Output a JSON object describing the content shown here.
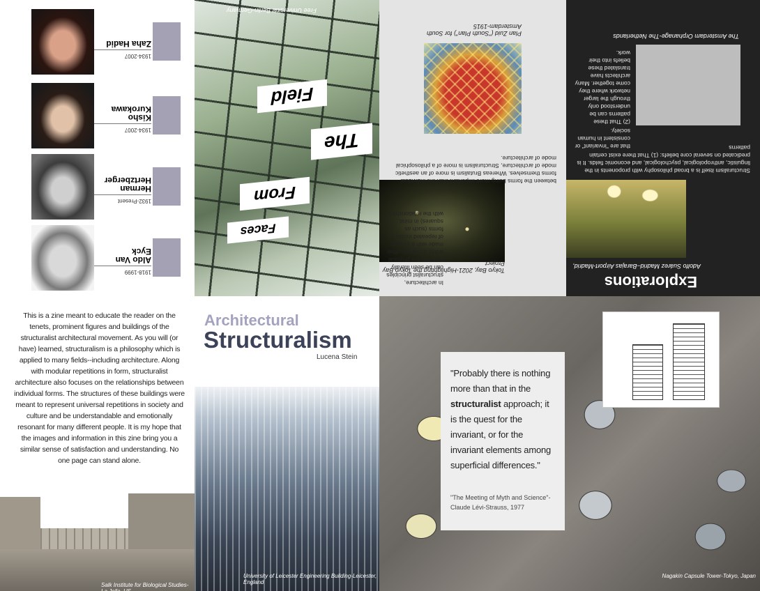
{
  "architects": [
    {
      "name": "Zaha Hadid",
      "years": "1934-2007"
    },
    {
      "name": "Kisho Kurokawa",
      "years": "1934-2007"
    },
    {
      "name": "Herman Hertzberger",
      "years": "1932-Present"
    },
    {
      "name": "Aldo Van Eyck",
      "years": "1918-1999"
    }
  ],
  "faces_panel": {
    "caption": "Free Universität Berlin-Germany",
    "words": [
      "Field",
      "The",
      "From",
      "Faces"
    ]
  },
  "tokyo_panel": {
    "plan_caption": "Plan Zuid (\"South Plan\") for South Amsterdam-1915",
    "tokyo_caption": "Tokyo Bay, 2021-Highlighting the Tokyo Bay Project",
    "text_left": "In architecture, structuralist principles can be seen literally built into the physical world. Buildings often made with a system of repeated motifs or forms (such as squares) in mind, with the relationships",
    "text_wide": "between the forms being more important than the individual forms themselves. Whereas Brutalism is more of an aesthetic mode of architecture, Structuralism is more of a philosophical mode of architecture."
  },
  "explorations_panel": {
    "title": "Explorations",
    "orphanage_caption": "The Amsterdam Orphanage-The Netherlands",
    "airport_caption": "Adolfo Suárez Madrid–Barajas Airport-Madrid,",
    "text_narrow": "(2) That these patterns can be understood only through the larger network where they come together. Many architects have translated these beliefs into their work.",
    "text_right": "that are \"invariant\" or consistent in human society.",
    "text_wide": "Structuralism itself is a broad philosophy with proponents in the linguistic, anthropological, psychological, and economic fields. It is predicated on several core beliefs: (1) That there exist certain patterns"
  },
  "intro": {
    "text": "This is a zine meant to educate the reader on the tenets, prominent figures and buildings of the structuralist architectural movement. As you will (or have) learned, structuralism is a philosophy which is applied to many fields--including architecture. Along with modular repetitions in form, structuralist architecture also focuses on the relationships between individual forms. The structures of these buildings were meant to represent universal repetitions in society and culture and be understandable and emotionally resonant for many different people. It is my hope that the images and information in this zine bring you a similar sense of satisfaction and understanding. No one page can stand alone.",
    "salk_caption": "Salk Institute for Biological Studies-La Jolla, US"
  },
  "cover": {
    "title_line1": "Architectural",
    "title_line2": "Structuralism",
    "author": "Lucena Stein",
    "caption": "University of Leicester Engineering Building-Leicester, England"
  },
  "quote_panel": {
    "quote_pre": "\"Probably there is nothing more than that in the ",
    "quote_bold": "structuralist",
    "quote_post": " approach; it is the quest for the invariant, or for the invariant elements among superficial differences.\"",
    "source": "\"The Meeting of Myth and Science\"-Claude Lévi-Strauss, 1977",
    "caption": "Nagakin Capsule Tower-Tokyo, Japan"
  }
}
